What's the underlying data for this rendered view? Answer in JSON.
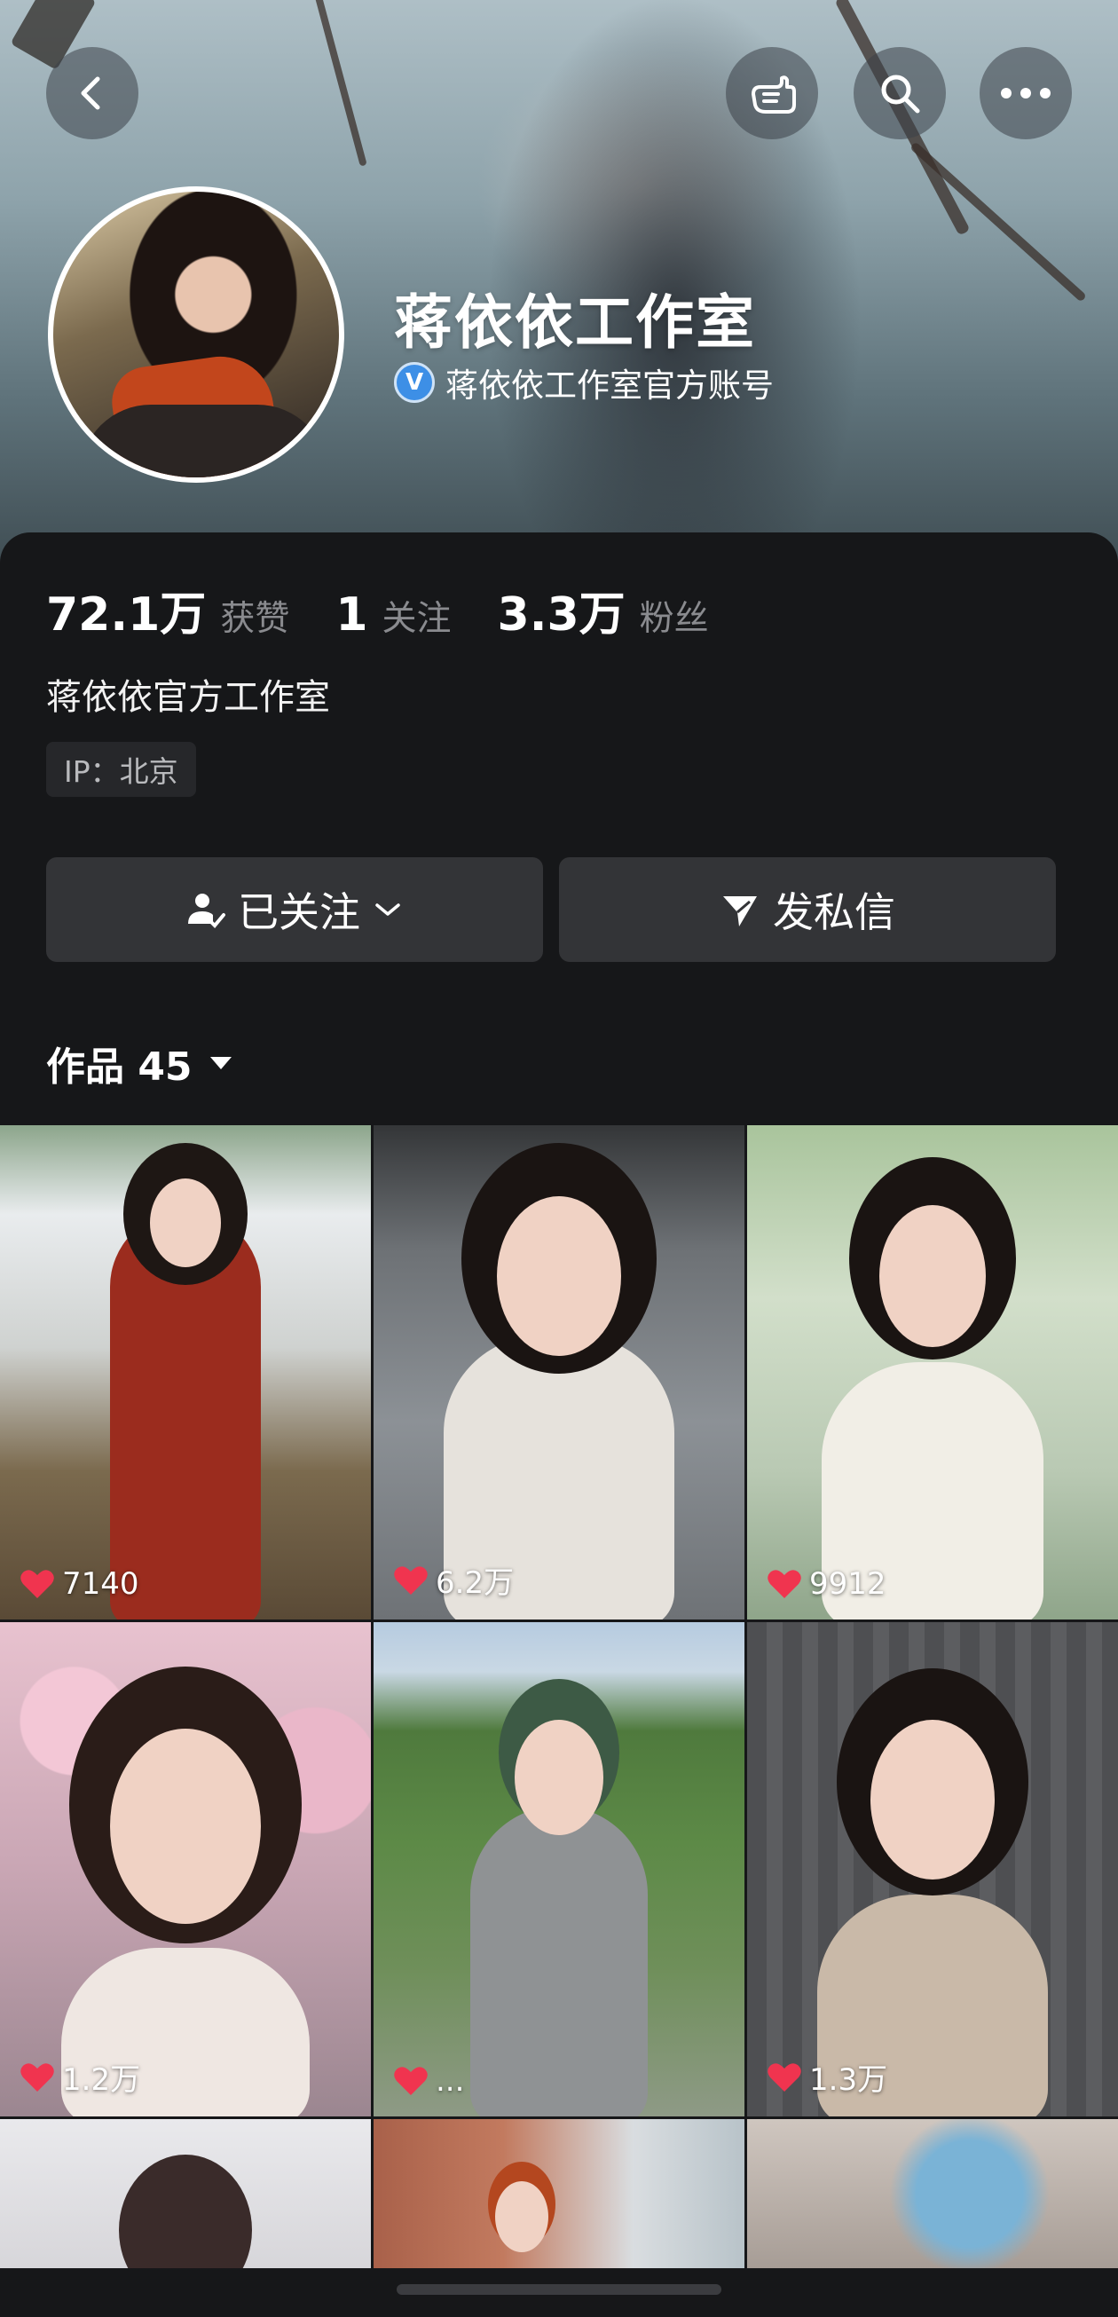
{
  "header": {
    "back_icon": "chevron-left-icon",
    "share_icon": "pointing-hand-icon",
    "search_icon": "search-icon",
    "more_icon": "more-dots-icon"
  },
  "profile": {
    "name": "蒋依依工作室",
    "verified_badge": "V",
    "verified_text": "蒋依依工作室官方账号",
    "bio": "蒋依依官方工作室",
    "ip": "IP：北京"
  },
  "stats": [
    {
      "value": "72.1万",
      "label": "获赞"
    },
    {
      "value": "1",
      "label": "关注"
    },
    {
      "value": "3.3万",
      "label": "粉丝"
    }
  ],
  "actions": {
    "follow_label": "已关注",
    "message_label": "发私信"
  },
  "works": {
    "title": "作品 45"
  },
  "videos": [
    {
      "likes": "7140"
    },
    {
      "likes": "6.2万"
    },
    {
      "likes": "9912"
    },
    {
      "likes": "1.2万"
    },
    {
      "likes": "..."
    },
    {
      "likes": "1.3万"
    }
  ],
  "colors": {
    "background": "#161719",
    "button": "#333437",
    "heart": "#f0344f",
    "verify_badge": "#3d8fe6"
  }
}
